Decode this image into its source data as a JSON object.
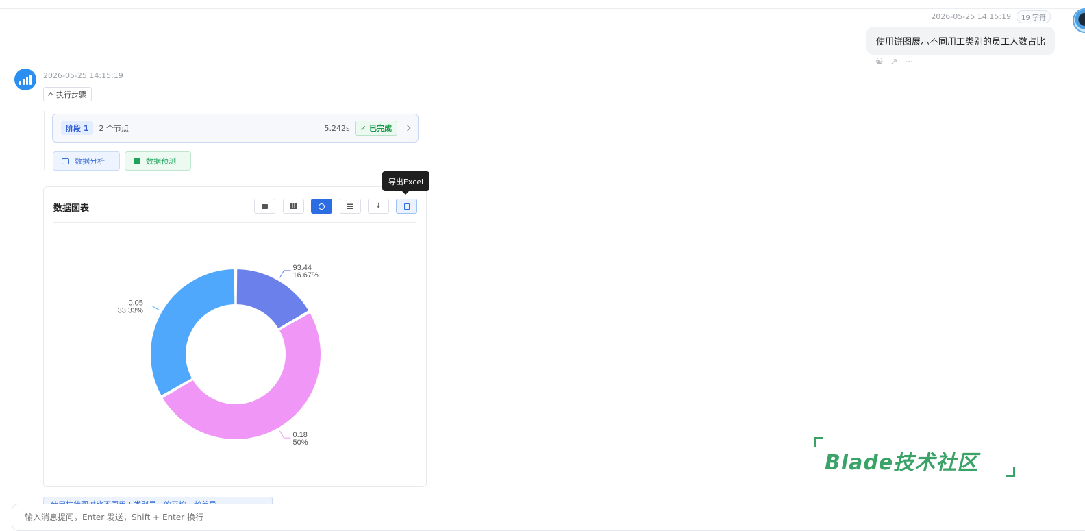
{
  "user_message": {
    "timestamp": "2026-05-25 14:15:19",
    "char_count": "19 字符",
    "text": "使用饼图展示不同用工类别的员工人数占比"
  },
  "bot_message": {
    "timestamp": "2026-05-25 14:15:19",
    "steps_toggle": "执行步骤",
    "stage": {
      "tag": "阶段 1",
      "nodes": "2 个节点",
      "duration": "5.242s",
      "status": "已完成"
    },
    "tools": [
      {
        "label": "数据分析"
      },
      {
        "label": "数据预测"
      }
    ],
    "chart_card": {
      "title": "数据图表",
      "toolbar": [
        {
          "icon": "image-icon"
        },
        {
          "icon": "bar-chart-icon"
        },
        {
          "icon": "pie-chart-icon",
          "active": true
        },
        {
          "icon": "table-icon"
        },
        {
          "icon": "download-icon"
        },
        {
          "icon": "excel-export-icon",
          "hover": true
        }
      ],
      "tooltip": "导出Excel"
    }
  },
  "chart_data": {
    "type": "pie",
    "donut": true,
    "slices": [
      {
        "value": 93.44,
        "percent": "16.67%",
        "label": "93.44",
        "color": "#6b80ea"
      },
      {
        "value": 0.18,
        "percent": "50%",
        "label": "0.18",
        "color": "#f096f7"
      },
      {
        "value": 0.05,
        "percent": "33.33%",
        "label": "0.05",
        "color": "#4fa8fb"
      }
    ],
    "shares": [
      16.67,
      50,
      33.33
    ]
  },
  "suggestion": "使用柱状图对比不同用工类别员工的平均工龄差异",
  "input": {
    "placeholder": "输入消息提问，Enter 发送，Shift + Enter 换行"
  },
  "watermark": "Blade技术社区",
  "colors": {
    "accent": "#2c6de4",
    "success": "#1a9c4b",
    "watermark": "#3aa368"
  }
}
